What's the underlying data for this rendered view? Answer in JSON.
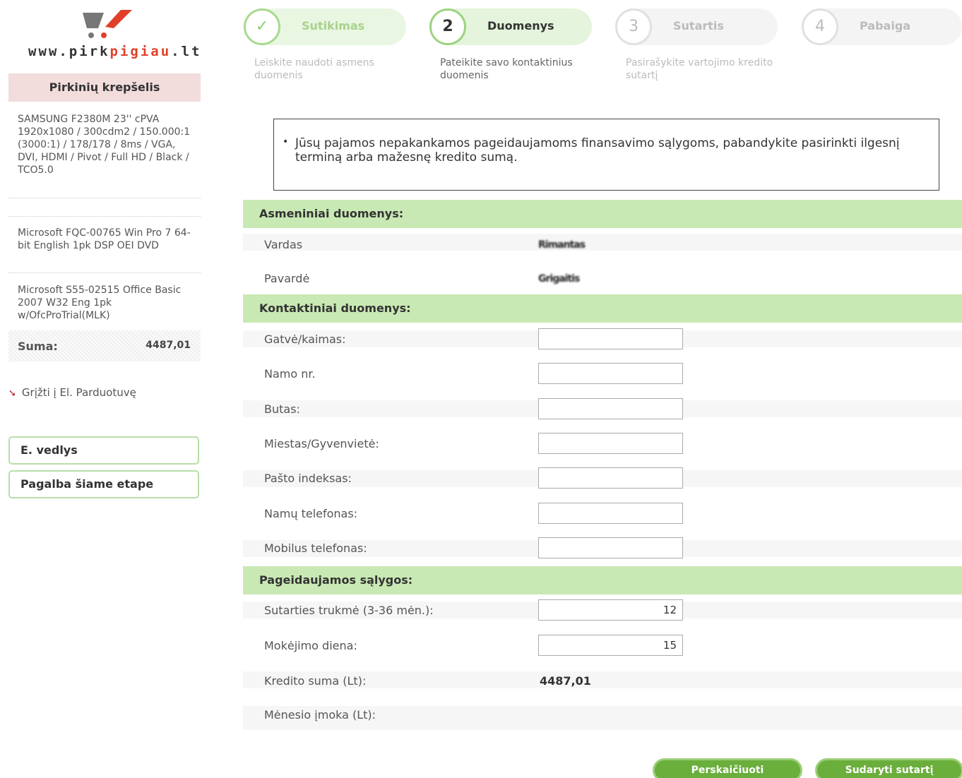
{
  "logo": {
    "text_before": "www.pirk",
    "text_accent": "pigiau",
    "text_after": ".lt"
  },
  "cart": {
    "header": "Pirkinių krepšelis",
    "items": [
      "SAMSUNG F2380M 23'' cPVA 1920x1080 / 300cdm2 / 150.000:1 (3000:1) / 178/178 / 8ms / VGA, DVI, HDMI / Pivot / Full HD / Black / TCO5.0",
      "Microsoft FQC-00765 Win Pro 7 64-bit English 1pk DSP OEI DVD",
      "Microsoft S55-02515 Office Basic 2007 W32 Eng 1pk w/OfcProTrial(MLK)"
    ],
    "sum_label": "Suma:",
    "sum_value": "4487,01"
  },
  "back_link": "Grįžti į El. Parduotuvę",
  "side_buttons": {
    "wizard": "E. vedlys",
    "help": "Pagalba šiame etape"
  },
  "steps": [
    {
      "number": "✓",
      "title": "Sutikimas",
      "desc": "Leiskite naudoti asmens duomenis"
    },
    {
      "number": "2",
      "title": "Duomenys",
      "desc": "Pateikite savo kontaktinius duomenis"
    },
    {
      "number": "3",
      "title": "Sutartis",
      "desc": "Pasirašykite vartojimo kredito sutartį"
    },
    {
      "number": "4",
      "title": "Pabaiga",
      "desc": ""
    }
  ],
  "alert": {
    "message": "Jūsų pajamos nepakankamos pageidaujamoms finansavimo sąlygoms, pabandykite pasirinkti ilgesnį terminą arba mažesnę kredito sumą."
  },
  "sections": {
    "personal": "Asmeniniai duomenys:",
    "contact": "Kontaktiniai duomenys:",
    "conditions": "Pageidaujamos sąlygos:"
  },
  "personal": {
    "name_label": "Vardas",
    "name_value": "Rimantas",
    "surname_label": "Pavardė",
    "surname_value": "Grigaitis"
  },
  "contact": {
    "street_label": "Gatvė/kaimas:",
    "house_label": "Namo nr.",
    "flat_label": "Butas:",
    "city_label": "Miestas/Gyvenvietė:",
    "postcode_label": "Pašto indeksas:",
    "home_phone_label": "Namų telefonas:",
    "mobile_label": "Mobilus telefonas:"
  },
  "conditions": {
    "duration_label": "Sutarties trukmė (3-36 mėn.):",
    "duration_value": "12",
    "payday_label": "Mokėjimo diena:",
    "payday_value": "15",
    "credit_label": "Kredito suma (Lt):",
    "credit_value": "4487,01",
    "monthly_label": "Mėnesio įmoka (Lt):",
    "monthly_value": ""
  },
  "buttons": {
    "recalculate": "Perskaičiuoti",
    "create_contract": "Sudaryti sutartį"
  },
  "colors": {
    "accent_green": "#c9e9b4",
    "button_green": "#6aae3c",
    "logo_red": "#e0402a",
    "cart_pink": "#f2dcdc"
  }
}
